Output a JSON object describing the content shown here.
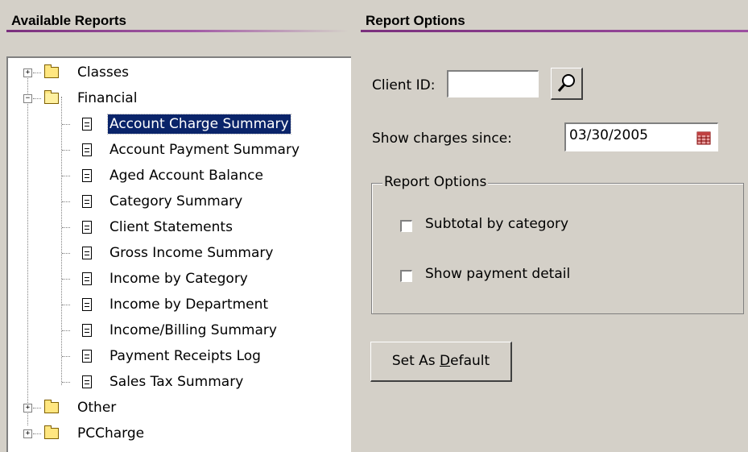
{
  "left_panel": {
    "title": "Available Reports",
    "tree": {
      "folders": [
        {
          "label": "Classes",
          "expanded": false
        },
        {
          "label": "Financial",
          "expanded": true
        },
        {
          "label": "Other",
          "expanded": false
        },
        {
          "label": "PCCharge",
          "expanded": false
        }
      ],
      "financial_reports": [
        "Account Charge Summary",
        "Account Payment Summary",
        "Aged Account Balance",
        "Category Summary",
        "Client Statements",
        "Gross Income Summary",
        "Income by Category",
        "Income by Department",
        "Income/Billing Summary",
        "Payment Receipts Log",
        "Sales Tax Summary"
      ],
      "selected": "Account Charge Summary"
    }
  },
  "right_panel": {
    "title": "Report Options",
    "client_id_label": "Client ID:",
    "client_id_value": "",
    "show_charges_label": "Show charges since:",
    "show_charges_value": "03/30/2005",
    "group_title": "Report Options",
    "checkboxes": [
      {
        "label": "Subtotal by category",
        "checked": false
      },
      {
        "label": "Show payment detail",
        "checked": false
      }
    ],
    "default_button_label": "Set As Default",
    "default_button_mnemonic": "D"
  },
  "colors": {
    "selection": "#0a246a",
    "header_rule": "#7a2f7d",
    "window_bg": "#d4d0c8"
  },
  "icons": {
    "lookup": "magnifier-icon",
    "calendar": "calendar-icon",
    "folder_closed": "folder-icon",
    "folder_open": "folder-open-icon",
    "report": "document-icon"
  }
}
